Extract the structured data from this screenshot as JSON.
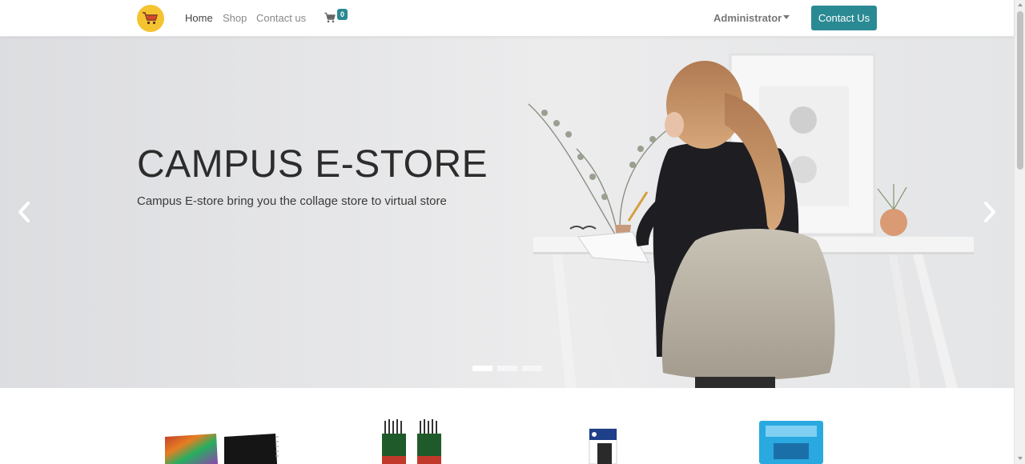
{
  "navbar": {
    "logo_icon": "shopping-cart-logo-icon",
    "links": [
      {
        "label": "Home",
        "active": true
      },
      {
        "label": "Shop",
        "active": false
      },
      {
        "label": "Contact us",
        "active": false
      }
    ],
    "cart_icon": "cart-icon",
    "cart_count": "0",
    "user_menu_label": "Administrator",
    "contact_button_label": "Contact Us",
    "accent_color": "#2a8a93"
  },
  "hero": {
    "title": "CAMPUS E-STORE",
    "subtitle": "Campus E-store bring you the collage store to virtual store",
    "prev_icon": "chevron-left-icon",
    "next_icon": "chevron-right-icon",
    "slide_count": 3,
    "active_slide": 1
  },
  "products": [
    {
      "icon": "notebook-product-image"
    },
    {
      "icon": "pencils-product-image"
    },
    {
      "icon": "pens-product-image"
    },
    {
      "icon": "stationery-pack-product-image"
    }
  ]
}
